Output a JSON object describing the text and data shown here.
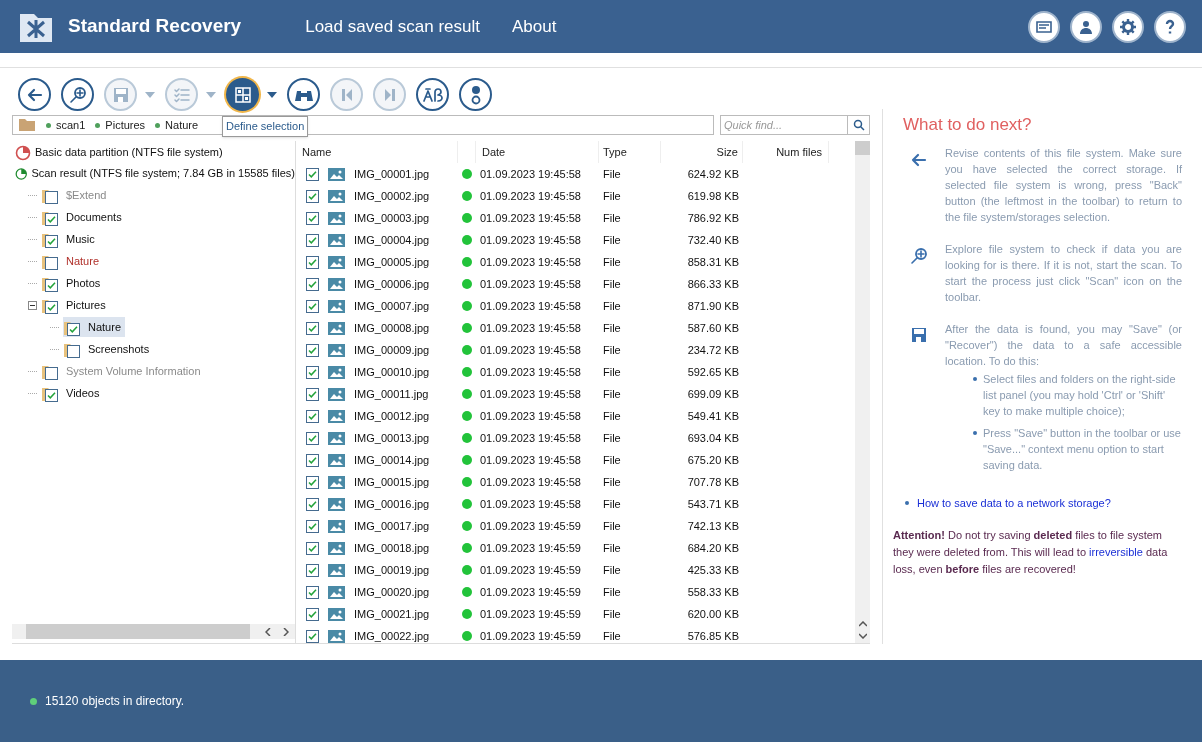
{
  "app": {
    "title": "Standard Recovery",
    "menu": [
      "Load saved scan result",
      "About"
    ]
  },
  "toolbar": [
    {
      "kind": "back",
      "disabled": false,
      "selected": false,
      "dropdown": false
    },
    {
      "kind": "explore",
      "disabled": false,
      "selected": false,
      "dropdown": false
    },
    {
      "kind": "save",
      "disabled": true,
      "selected": false,
      "dropdown": true
    },
    {
      "kind": "list",
      "disabled": true,
      "selected": false,
      "dropdown": true
    },
    {
      "kind": "selection",
      "disabled": false,
      "selected": true,
      "dropdown": true
    },
    {
      "kind": "find",
      "disabled": false,
      "selected": false,
      "dropdown": false
    },
    {
      "kind": "prev",
      "disabled": true,
      "selected": false,
      "dropdown": false
    },
    {
      "kind": "next",
      "disabled": true,
      "selected": false,
      "dropdown": false
    },
    {
      "kind": "charset",
      "disabled": false,
      "selected": false,
      "dropdown": false
    },
    {
      "kind": "status",
      "disabled": false,
      "selected": false,
      "dropdown": false
    }
  ],
  "tooltip": "Define selection",
  "breadcrumb": [
    "scan1",
    "Pictures",
    "Nature"
  ],
  "quick_find": {
    "placeholder": "Quick find..."
  },
  "partitions": [
    {
      "kind": "partition",
      "label": "Basic data partition (NTFS file system)"
    },
    {
      "kind": "scan",
      "label": "Scan result (NTFS file system; 7.84 GB in 15585 files)"
    }
  ],
  "tree": [
    {
      "label": "$Extend",
      "kind": "system",
      "checked": false,
      "selected": false
    },
    {
      "label": "Documents",
      "kind": "normal",
      "checked": true,
      "selected": false
    },
    {
      "label": "Music",
      "kind": "normal",
      "checked": true,
      "selected": false
    },
    {
      "label": "Nature",
      "kind": "deleted",
      "checked": false,
      "selected": false
    },
    {
      "label": "Photos",
      "kind": "normal",
      "checked": true,
      "selected": false
    },
    {
      "label": "Pictures",
      "kind": "normal",
      "checked": true,
      "selected": false,
      "expanded": true,
      "children": [
        {
          "label": "Nature",
          "kind": "normal",
          "checked": true,
          "selected": true
        },
        {
          "label": "Screenshots",
          "kind": "normal",
          "checked": false,
          "selected": false
        }
      ]
    },
    {
      "label": "System Volume Information",
      "kind": "system",
      "checked": false,
      "selected": false
    },
    {
      "label": "Videos",
      "kind": "normal",
      "checked": true,
      "selected": false
    }
  ],
  "table": {
    "columns": [
      "Name",
      "Date",
      "Type",
      "Size",
      "Num files"
    ],
    "rows": [
      {
        "name": "IMG_00001.jpg",
        "date": "01.09.2023 19:45:58",
        "type": "File",
        "size": "624.92 KB",
        "checked": true,
        "color": "#22c33a"
      },
      {
        "name": "IMG_00002.jpg",
        "date": "01.09.2023 19:45:58",
        "type": "File",
        "size": "619.98 KB",
        "checked": true,
        "color": "#22c33a"
      },
      {
        "name": "IMG_00003.jpg",
        "date": "01.09.2023 19:45:58",
        "type": "File",
        "size": "786.92 KB",
        "checked": true,
        "color": "#22c33a"
      },
      {
        "name": "IMG_00004.jpg",
        "date": "01.09.2023 19:45:58",
        "type": "File",
        "size": "732.40 KB",
        "checked": true,
        "color": "#22c33a"
      },
      {
        "name": "IMG_00005.jpg",
        "date": "01.09.2023 19:45:58",
        "type": "File",
        "size": "858.31 KB",
        "checked": true,
        "color": "#22c33a"
      },
      {
        "name": "IMG_00006.jpg",
        "date": "01.09.2023 19:45:58",
        "type": "File",
        "size": "866.33 KB",
        "checked": true,
        "color": "#22c33a"
      },
      {
        "name": "IMG_00007.jpg",
        "date": "01.09.2023 19:45:58",
        "type": "File",
        "size": "871.90 KB",
        "checked": true,
        "color": "#22c33a"
      },
      {
        "name": "IMG_00008.jpg",
        "date": "01.09.2023 19:45:58",
        "type": "File",
        "size": "587.60 KB",
        "checked": true,
        "color": "#22c33a"
      },
      {
        "name": "IMG_00009.jpg",
        "date": "01.09.2023 19:45:58",
        "type": "File",
        "size": "234.72 KB",
        "checked": true,
        "color": "#22c33a"
      },
      {
        "name": "IMG_00010.jpg",
        "date": "01.09.2023 19:45:58",
        "type": "File",
        "size": "592.65 KB",
        "checked": true,
        "color": "#22c33a"
      },
      {
        "name": "IMG_00011.jpg",
        "date": "01.09.2023 19:45:58",
        "type": "File",
        "size": "699.09 KB",
        "checked": true,
        "color": "#22c33a"
      },
      {
        "name": "IMG_00012.jpg",
        "date": "01.09.2023 19:45:58",
        "type": "File",
        "size": "549.41 KB",
        "checked": true,
        "color": "#22c33a"
      },
      {
        "name": "IMG_00013.jpg",
        "date": "01.09.2023 19:45:58",
        "type": "File",
        "size": "693.04 KB",
        "checked": true,
        "color": "#22c33a"
      },
      {
        "name": "IMG_00014.jpg",
        "date": "01.09.2023 19:45:58",
        "type": "File",
        "size": "675.20 KB",
        "checked": true,
        "color": "#22c33a"
      },
      {
        "name": "IMG_00015.jpg",
        "date": "01.09.2023 19:45:58",
        "type": "File",
        "size": "707.78 KB",
        "checked": true,
        "color": "#22c33a"
      },
      {
        "name": "IMG_00016.jpg",
        "date": "01.09.2023 19:45:58",
        "type": "File",
        "size": "543.71 KB",
        "checked": true,
        "color": "#22c33a"
      },
      {
        "name": "IMG_00017.jpg",
        "date": "01.09.2023 19:45:59",
        "type": "File",
        "size": "742.13 KB",
        "checked": true,
        "color": "#22c33a"
      },
      {
        "name": "IMG_00018.jpg",
        "date": "01.09.2023 19:45:59",
        "type": "File",
        "size": "684.20 KB",
        "checked": true,
        "color": "#22c33a"
      },
      {
        "name": "IMG_00019.jpg",
        "date": "01.09.2023 19:45:59",
        "type": "File",
        "size": "425.33 KB",
        "checked": true,
        "color": "#22c33a"
      },
      {
        "name": "IMG_00020.jpg",
        "date": "01.09.2023 19:45:59",
        "type": "File",
        "size": "558.33 KB",
        "checked": true,
        "color": "#22c33a"
      },
      {
        "name": "IMG_00021.jpg",
        "date": "01.09.2023 19:45:59",
        "type": "File",
        "size": "620.00 KB",
        "checked": true,
        "color": "#22c33a"
      },
      {
        "name": "IMG_00022.jpg",
        "date": "01.09.2023 19:45:59",
        "type": "File",
        "size": "576.85 KB",
        "checked": true,
        "color": "#22c33a"
      }
    ]
  },
  "help": {
    "title": "What to do next?",
    "steps": [
      {
        "kind": "back",
        "text": "Revise contents of this file system. Make sure you have selected the correct storage. If selected file system is wrong, press \"Back\" button (the leftmost in the toolbar) to return to the file system/storages selection."
      },
      {
        "kind": "explore",
        "text": "Explore file system to check if data you are looking for is there. If it is not, start the scan. To start the process just click \"Scan\" icon on the toolbar."
      },
      {
        "kind": "save",
        "text": "After the data is found, you may \"Save\" (or \"Recover\") the data to a safe accessible location. To do this:",
        "bullets": [
          "Select files and folders on the right-side list panel (you may hold 'Ctrl' or 'Shift' key to make multiple choice);",
          "Press \"Save\" button in the toolbar or use \"Save...\" context menu option to start saving data."
        ]
      }
    ],
    "link": "How to save data to a network storage?",
    "attention": {
      "before": "**Attention!** Do not try saving **deleted** files to file system they were deleted from. This will lead to",
      "link": "irreversible",
      "after": "data loss, even **before** files are recovered!"
    }
  },
  "status_bar": "15120 objects in directory."
}
